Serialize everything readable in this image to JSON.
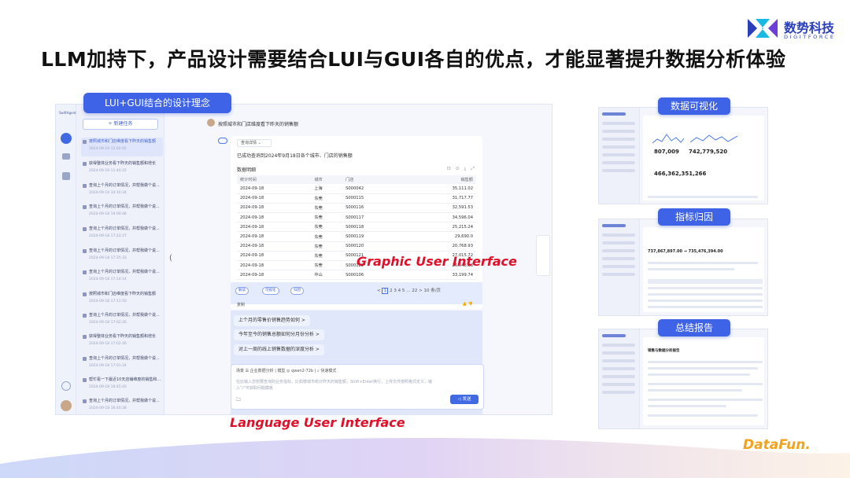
{
  "slide": {
    "title": "LLM加持下，产品设计需要结合LUI与GUI各自的优点，才能显著提升数据分析体验",
    "logo_cn": "数势科技",
    "logo_en": "DIGITFORCE",
    "footer_brand": "DataFun.",
    "labels": {
      "design_concept": "LUI+GUI结合的设计理念",
      "gui": "Graphic User Interface",
      "lui": "Language User Interface",
      "viz": "数据可视化",
      "attribution": "指标归因",
      "report": "总结报告"
    }
  },
  "app": {
    "brand": "SwiftAgent",
    "new_task": "+ 新建任务",
    "history": [
      {
        "title": "按照城市和门店维度看下昨天的销售额",
        "date": "2024-09-19 12:02:02",
        "active": true
      },
      {
        "title": "获得整体业务看下昨天的销售额和增长",
        "date": "2024-09-19 11:40:25"
      },
      {
        "title": "查询上个月的订单情况，并帮我做个说...",
        "date": "2024-09-19 10:10:34"
      },
      {
        "title": "查询上个月的订单情况，并帮我做个说...",
        "date": "2024-09-18 10:00:48"
      },
      {
        "title": "查询上个月的订单情况，并帮我做个说...",
        "date": "2024-09-18 17:22:27"
      },
      {
        "title": "查询上个月的订单情况，并帮我做个说...",
        "date": "2024-09-18 17:25:33"
      },
      {
        "title": "查询上个月的订单情况，并帮我做个说...",
        "date": "2024-09-18 17:14:14"
      },
      {
        "title": "按照城市和门店维度看下昨天的销售额",
        "date": "2024-09-18 17:11:50"
      },
      {
        "title": "查询上个月的订单情况，并帮我做个说...",
        "date": "2024-09-18 17:02:26"
      },
      {
        "title": "获得整体业务看下昨天的销售额和增长",
        "date": "2024-09-18 17:02:26"
      },
      {
        "title": "查询上个月的订单情况，并帮我做个说...",
        "date": "2024-09-18 17:01:24"
      },
      {
        "title": "帮忙看一下最近10天店铺维度的销售和...",
        "date": "2024-09-18 16:45:43"
      },
      {
        "title": "查询上个月的订单情况，并帮我做个说...",
        "date": "2024-09-18 16:40:28"
      }
    ],
    "user_question": "按照城市和门店维度看下昨天的销售额",
    "answer": {
      "select": "查询详情",
      "info": "已成功查询到2024年9月18日各个城市、门店的销售额",
      "table_title": "数据明细",
      "tools": "⊡ ⊙ ⤓ ⤢",
      "columns": [
        "统计时间",
        "城市",
        "门店",
        "销售额"
      ],
      "rows": [
        [
          "2024-09-18",
          "上海",
          "S000042",
          "35,111.02"
        ],
        [
          "2024-09-18",
          "东莞",
          "S000115",
          "31,717.77"
        ],
        [
          "2024-09-18",
          "东莞",
          "S000116",
          "32,591.53"
        ],
        [
          "2024-09-18",
          "东莞",
          "S000117",
          "34,596.04"
        ],
        [
          "2024-09-18",
          "东莞",
          "S000118",
          "25,215.24"
        ],
        [
          "2024-09-18",
          "东莞",
          "S000119",
          "29,690.0"
        ],
        [
          "2024-09-18",
          "东莞",
          "S000120",
          "20,768.93"
        ],
        [
          "2024-09-18",
          "东莞",
          "S000121",
          "27,015.72"
        ],
        [
          "2024-09-18",
          "东莞",
          "S000122",
          "26,048.88"
        ],
        [
          "2024-09-18",
          "中山",
          "S000106",
          "33,199.74"
        ]
      ],
      "buttons": [
        "解读",
        "可视化",
        "归因"
      ],
      "pager": {
        "prev": "<",
        "current": "1",
        "pages": "2  3  4  5  …  22  >",
        "size": "10 条/页"
      },
      "copy": "复制",
      "feedback": "👍 👎"
    },
    "suggestions": [
      "上个月的零售价销售趋势如何 >",
      "今年至今的销售总额如何分月份分析 >",
      "对上一周的线上销售数据的深度分析 >"
    ],
    "input": {
      "toolbar": "场景  ☰ 企业数据分析  |  模型  ◎ qwen2-72b  |  ⌕ 快速模式",
      "placeholder": "在此输入您想要查询的业务指标，比如按城市统计昨天的销售额，Shift+Enter换行，上传文件按照格式定义，输入“/”可获取问题模板",
      "send": "◁ 发送",
      "attach": "🗀"
    }
  },
  "panels": {
    "viz": {
      "kpis": [
        "807,009",
        "742,779,520",
        "466,362,351,266"
      ]
    },
    "attribution": {
      "headline": "737,867,897.00  →  735,476,394.00"
    },
    "report": {
      "heading": "销售与数据分析报告"
    }
  },
  "colors": {
    "accent": "#3f63e6",
    "label_red": "#e0102a",
    "brand_orange": "#f2a21b"
  }
}
